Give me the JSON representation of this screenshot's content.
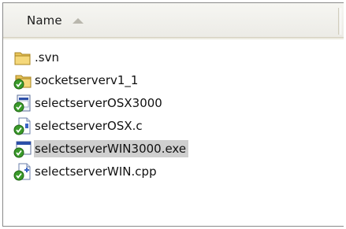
{
  "header": {
    "name_label": "Name"
  },
  "files": [
    {
      "name": ".svn",
      "icon": "folder-icon"
    },
    {
      "name": "socketserverv1_1",
      "icon": "svn-folder-icon"
    },
    {
      "name": "selectserverOSX3000",
      "icon": "svn-file-icon"
    },
    {
      "name": "selectserverOSX.c",
      "icon": "svn-c-source-icon"
    },
    {
      "name": "selectserverWIN3000.exe",
      "icon": "svn-exe-icon",
      "selected": true
    },
    {
      "name": "selectserverWIN.cpp",
      "icon": "svn-cpp-source-icon"
    }
  ],
  "colors": {
    "selection": "#cfcfcf",
    "header_bg": "#ecebe6",
    "svn_badge": "#3a9a2a"
  }
}
